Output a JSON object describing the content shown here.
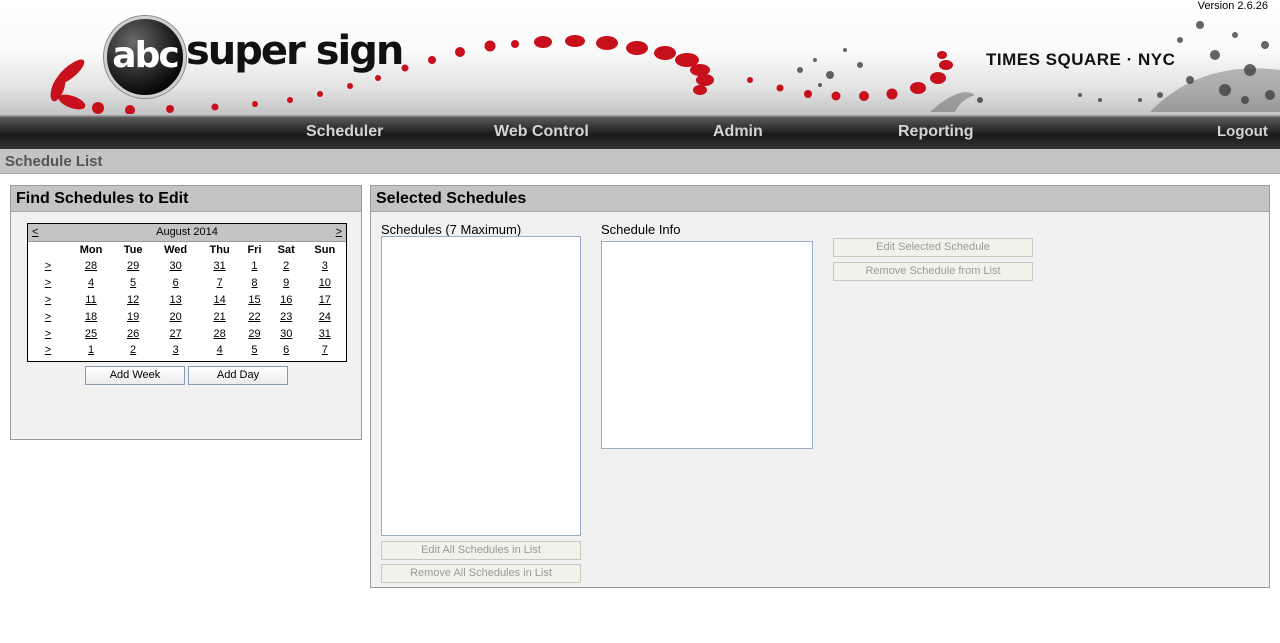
{
  "header": {
    "logo_mark": "abc",
    "logo_text": "super sign",
    "location": "TIMES SQUARE · NYC",
    "version": "Version 2.6.26"
  },
  "nav": {
    "items": [
      {
        "label": "Scheduler"
      },
      {
        "label": "Web Control"
      },
      {
        "label": "Admin"
      },
      {
        "label": "Reporting"
      }
    ],
    "logout": "Logout"
  },
  "page_title": "Schedule List",
  "find_panel": {
    "title": "Find Schedules to Edit",
    "calendar": {
      "prev": "<",
      "next": ">",
      "month": "August 2014",
      "weekdays": [
        "Mon",
        "Tue",
        "Wed",
        "Thu",
        "Fri",
        "Sat",
        "Sun"
      ],
      "week_selector": ">",
      "weeks": [
        [
          "28",
          "29",
          "30",
          "31",
          "1",
          "2",
          "3"
        ],
        [
          "4",
          "5",
          "6",
          "7",
          "8",
          "9",
          "10"
        ],
        [
          "11",
          "12",
          "13",
          "14",
          "15",
          "16",
          "17"
        ],
        [
          "18",
          "19",
          "20",
          "21",
          "22",
          "23",
          "24"
        ],
        [
          "25",
          "26",
          "27",
          "28",
          "29",
          "30",
          "31"
        ],
        [
          "1",
          "2",
          "3",
          "4",
          "5",
          "6",
          "7"
        ]
      ]
    },
    "add_week": "Add Week",
    "add_day": "Add Day"
  },
  "selected_panel": {
    "title": "Selected Schedules",
    "schedules_label": "Schedules (7 Maximum)",
    "info_label": "Schedule Info",
    "edit_selected": "Edit Selected Schedule",
    "remove_from_list": "Remove Schedule from List",
    "edit_all": "Edit All Schedules in List",
    "remove_all": "Remove All Schedules in List"
  },
  "colors": {
    "accent_red": "#c8101c",
    "nav_text": "#d4d4d4",
    "panel_bg": "#f1f1f1",
    "panel_header": "#c4c4c4"
  }
}
